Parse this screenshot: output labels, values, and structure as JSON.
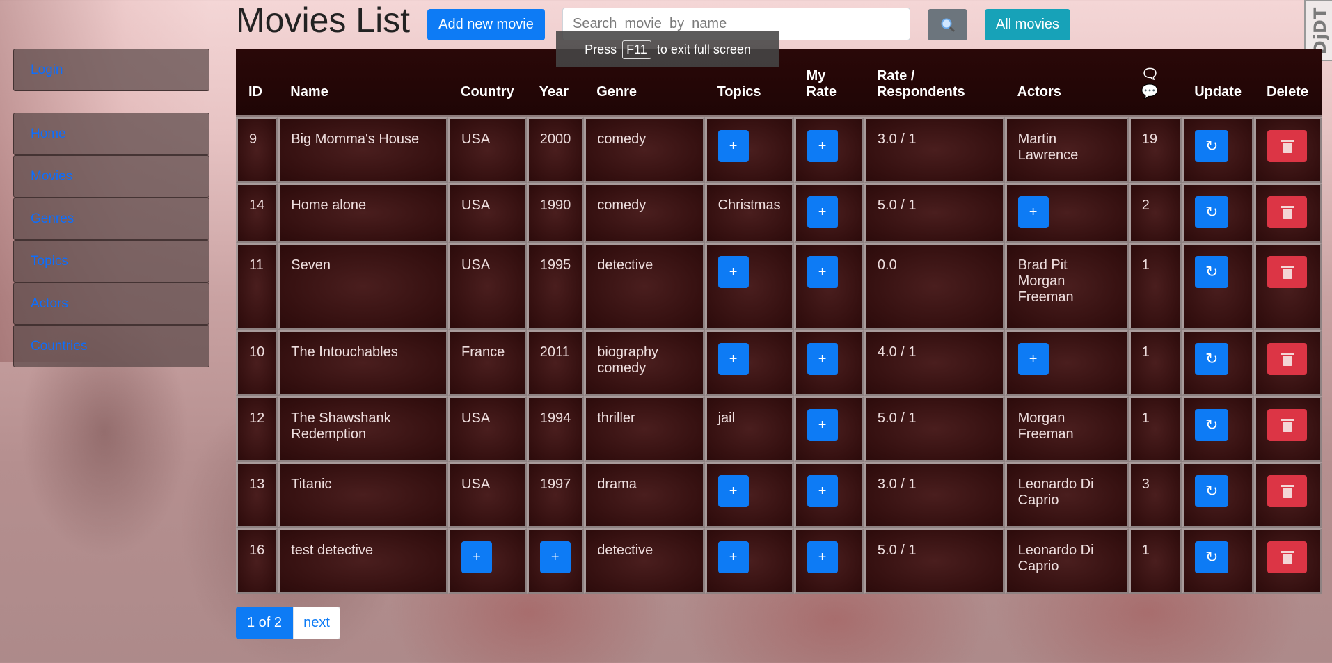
{
  "sidebar": {
    "items": [
      {
        "label": "Login"
      },
      {
        "label": "Home"
      },
      {
        "label": "Movies"
      },
      {
        "label": "Genres"
      },
      {
        "label": "Topics"
      },
      {
        "label": "Actors"
      },
      {
        "label": "Countries"
      }
    ]
  },
  "header": {
    "title": "Movies List",
    "add_label": "Add new movie",
    "search_placeholder": "Search  movie  by  name",
    "search_icon": "magnifier-icon",
    "all_label": "All movies"
  },
  "toolbar_badge": "DjDT",
  "fullscreen_notice": {
    "prefix": "Press",
    "key": "F11",
    "suffix": "to exit full screen"
  },
  "table": {
    "headers": {
      "id": "ID",
      "name": "Name",
      "country": "Country",
      "year": "Year",
      "genre": "Genre",
      "topics": "Topics",
      "my_rate_1": "My",
      "my_rate_2": "Rate",
      "rate_1": "Rate /",
      "rate_2": "Respondents",
      "actors": "Actors",
      "comments_1": "🗨",
      "comments_2": "💬",
      "update": "Update",
      "delete": "Delete"
    },
    "rows": [
      {
        "id": "9",
        "name": "Big Momma's House",
        "country": "USA",
        "year": "2000",
        "genre": "comedy",
        "topics": "",
        "rate": "3.0 / 1",
        "actors": "Martin Lawrence",
        "comments": "19"
      },
      {
        "id": "14",
        "name": "Home alone",
        "country": "USA",
        "year": "1990",
        "genre": "comedy",
        "topics": "Christmas",
        "rate": "5.0 / 1",
        "actors": "",
        "comments": "2"
      },
      {
        "id": "11",
        "name": "Seven",
        "country": "USA",
        "year": "1995",
        "genre": "detective",
        "topics": "",
        "rate": "0.0",
        "actors": "Brad Pit Morgan Freeman",
        "comments": "1"
      },
      {
        "id": "10",
        "name": "The Intouchables",
        "country": "France",
        "year": "2011",
        "genre": "biography comedy",
        "topics": "",
        "rate": "4.0 / 1",
        "actors": "",
        "comments": "1"
      },
      {
        "id": "12",
        "name": "The Shawshank Redemption",
        "country": "USA",
        "year": "1994",
        "genre": "thriller",
        "topics": "jail",
        "rate": "5.0 / 1",
        "actors": "Morgan Freeman",
        "comments": "1"
      },
      {
        "id": "13",
        "name": "Titanic",
        "country": "USA",
        "year": "1997",
        "genre": "drama",
        "topics": "",
        "rate": "3.0 / 1",
        "actors": "Leonardo Di Caprio",
        "comments": "3"
      },
      {
        "id": "16",
        "name": "test detective",
        "country": "",
        "year": "",
        "genre": "detective",
        "topics": "",
        "rate": "5.0 / 1",
        "actors": "Leonardo Di Caprio",
        "comments": "1"
      }
    ],
    "plus_label": "+",
    "update_label": "↻"
  },
  "pagination": {
    "current": "1 of 2",
    "next": "next"
  }
}
